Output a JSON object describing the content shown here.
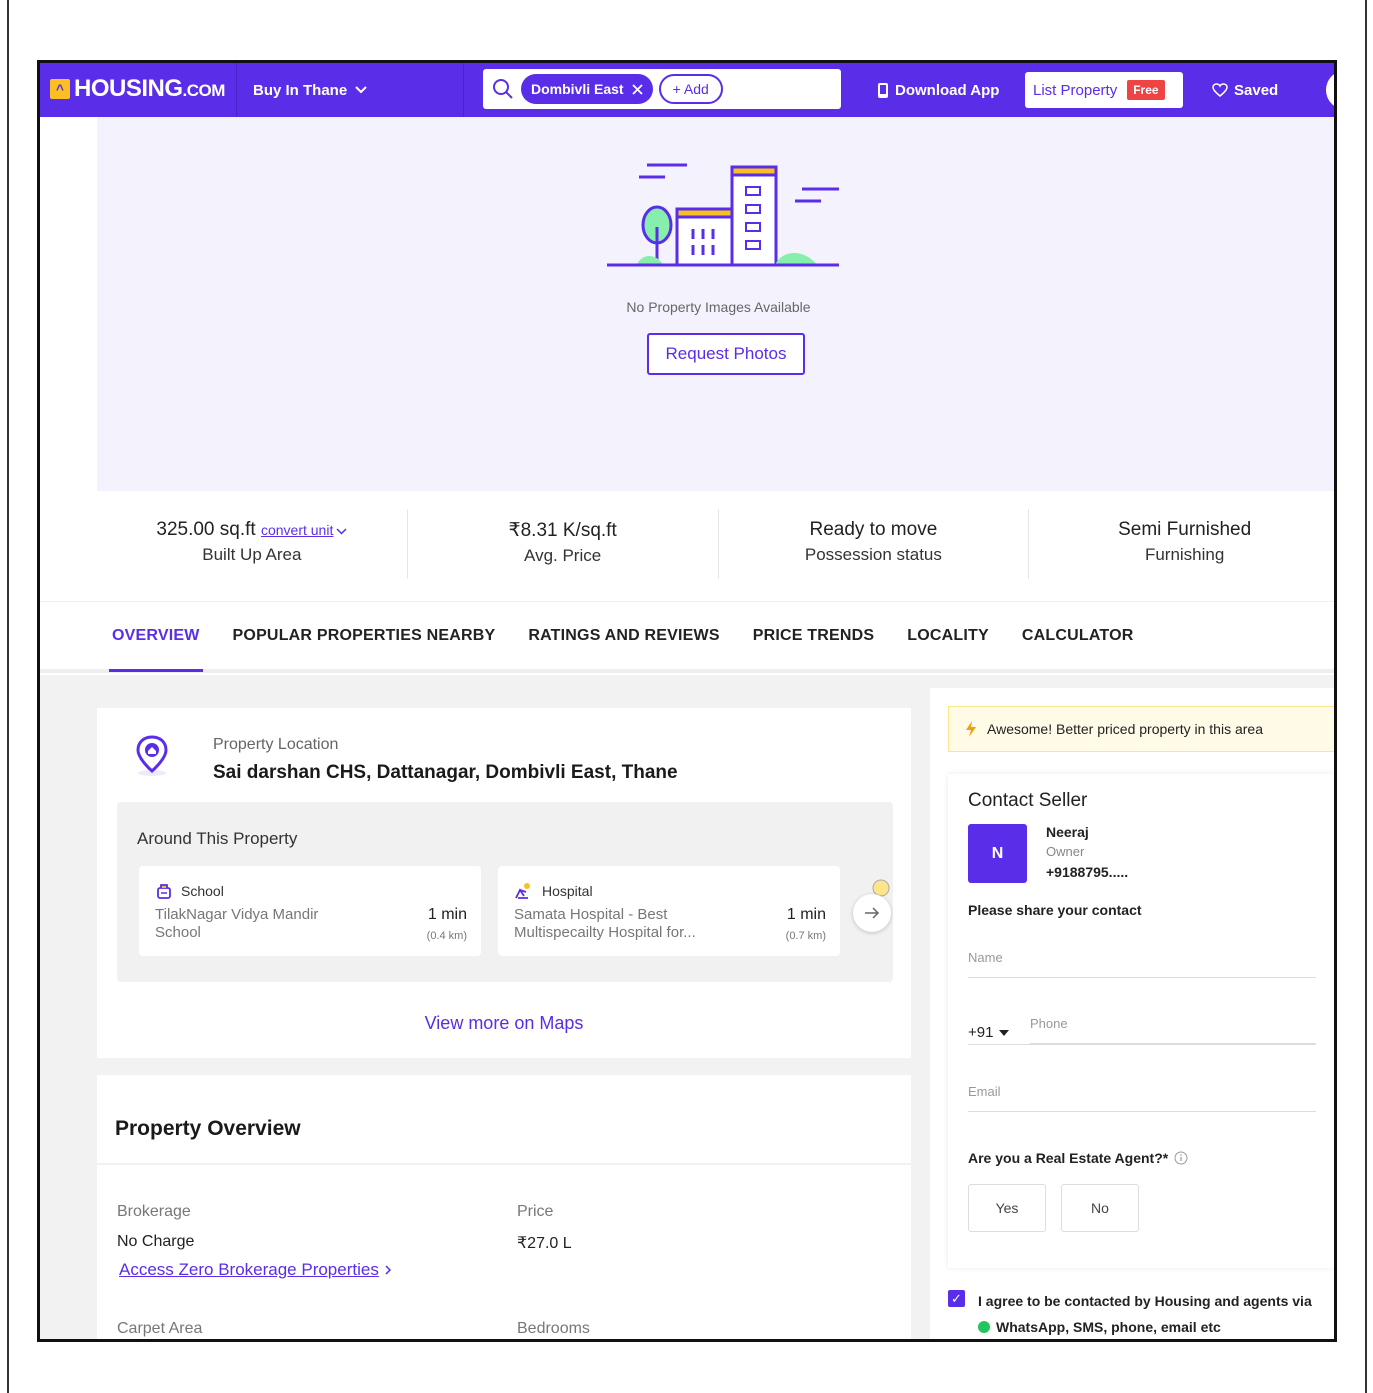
{
  "header": {
    "logo_mark": "^",
    "logo_main": "HOUSING",
    "logo_suffix": ".COM",
    "city_button": "Buy In Thane",
    "search_chip": "Dombivli East",
    "add_chip": "+ Add",
    "download_app": "Download App",
    "list_property": "List Property",
    "free_badge": "Free",
    "saved": "Saved"
  },
  "hero": {
    "no_images": "No Property Images Available",
    "request_photos": "Request Photos"
  },
  "stats": [
    {
      "value": "325.00 sq.ft",
      "label": "Built Up Area",
      "extra": "convert unit"
    },
    {
      "value": "₹8.31 K/sq.ft",
      "label": "Avg. Price"
    },
    {
      "value": "Ready to move",
      "label": "Possession status"
    },
    {
      "value": "Semi Furnished",
      "label": "Furnishing"
    }
  ],
  "tabs": [
    "OVERVIEW",
    "POPULAR PROPERTIES NEARBY",
    "RATINGS AND REVIEWS",
    "PRICE TRENDS",
    "LOCALITY",
    "CALCULATOR"
  ],
  "location": {
    "label": "Property Location",
    "address": "Sai darshan CHS, Dattanagar, Dombivli East, Thane",
    "around_title": "Around This Property",
    "pois": [
      {
        "type": "School",
        "name": "TilakNagar Vidya Mandir School",
        "time": "1 min",
        "distance": "(0.4 km)"
      },
      {
        "type": "Hospital",
        "name": "Samata Hospital - Best Multispecailty Hospital for...",
        "time": "1 min",
        "distance": "(0.7 km)"
      }
    ],
    "view_maps": "View more on Maps"
  },
  "overview": {
    "title": "Property Overview",
    "brokerage_label": "Brokerage",
    "brokerage_value": "No Charge",
    "brokerage_link": "Access Zero Brokerage Properties",
    "price_label": "Price",
    "price_value": "₹27.0 L",
    "carpet_label": "Carpet Area",
    "bedrooms_label": "Bedrooms"
  },
  "contact": {
    "banner": "Awesome! Better priced property in this area",
    "title": "Contact Seller",
    "seller_initial": "N",
    "seller_name": "Neeraj",
    "seller_role": "Owner",
    "seller_phone": "+9188795.....",
    "share_prompt": "Please share your contact",
    "name_placeholder": "Name",
    "country_code": "+91",
    "phone_placeholder": "Phone",
    "email_placeholder": "Email",
    "agent_question": "Are you a Real Estate Agent?*",
    "yes": "Yes",
    "no": "No",
    "agree_line1": "I agree to be contacted by Housing and agents via",
    "agree_line2": "WhatsApp, SMS, phone, email etc"
  },
  "colors": {
    "brand": "#5a2de8",
    "accent_yellow": "#fbbf24",
    "free_badge": "#ef4444"
  }
}
